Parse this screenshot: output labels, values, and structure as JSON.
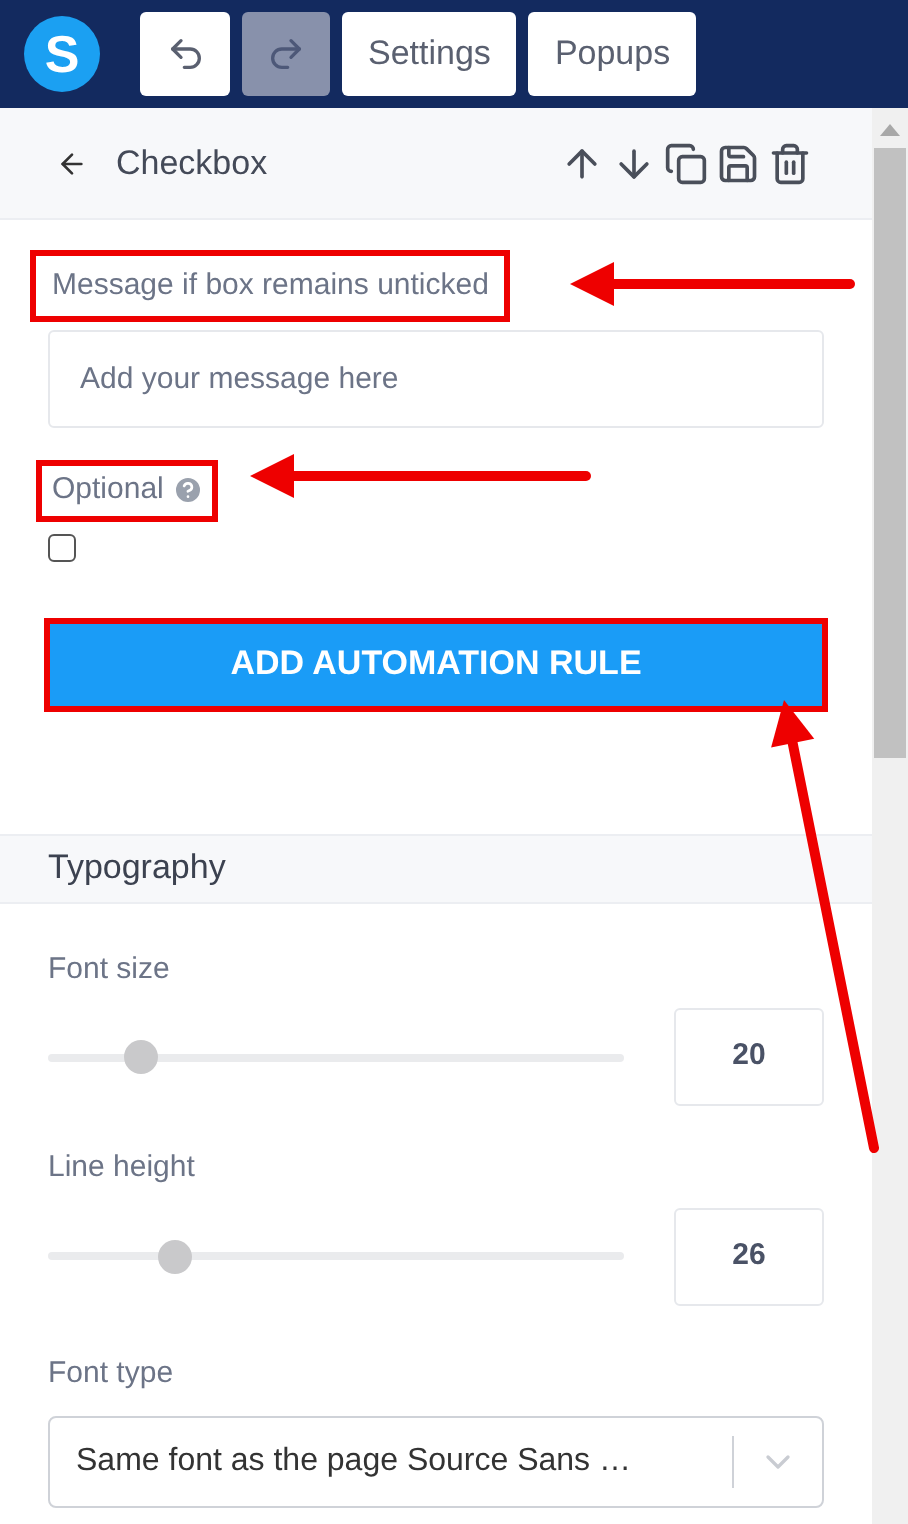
{
  "toolbar": {
    "logo": "S",
    "buttons": [
      {
        "kind": "undo",
        "disabled": false
      },
      {
        "kind": "redo",
        "disabled": true
      },
      {
        "kind": "text",
        "label": "Settings",
        "disabled": false
      },
      {
        "kind": "text",
        "label": "Popups",
        "disabled": false
      }
    ]
  },
  "header": {
    "title": "Checkbox",
    "actions": [
      {
        "kind": "up"
      },
      {
        "kind": "down"
      },
      {
        "kind": "copy"
      },
      {
        "kind": "save"
      },
      {
        "kind": "delete"
      }
    ]
  },
  "message_field": {
    "label": "Message if box remains unticked",
    "placeholder": "Add your message here",
    "highlighted": true
  },
  "optional": {
    "label": "Optional",
    "checked": false,
    "highlighted": true
  },
  "automation_button": {
    "label": "ADD AUTOMATION RULE",
    "highlighted": true
  },
  "typography": {
    "title": "Typography",
    "sliders": [
      {
        "label": "Font size",
        "level": 0.16,
        "value": "20"
      },
      {
        "label": "Line height",
        "level": 0.22,
        "value": "26"
      }
    ],
    "font_type": {
      "label": "Font type",
      "value": "Same font as the page Source Sans …"
    }
  }
}
